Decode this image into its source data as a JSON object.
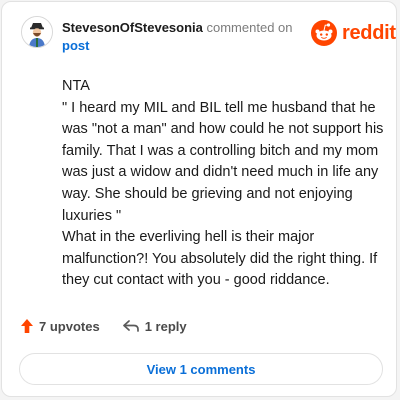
{
  "comment": {
    "username": "StevesonOfStevesonia",
    "action_text": " commented on",
    "post_link": "post",
    "body": [
      "NTA",
      "\" I heard my MIL and BIL tell me husband that he was \"not a man\" and how could he not support his family. That I was a controlling bitch and my mom was just a widow and didn't need much in life any way. She should be grieving and not enjoying luxuries \"",
      "What in the everliving hell is their major malfunction?! You absolutely did the right thing. If they cut contact with you - good riddance."
    ]
  },
  "brand": {
    "name": "reddit",
    "color": "#ff4500",
    "icon": "reddit-logo-icon"
  },
  "actions": {
    "upvotes_label": "7 upvotes",
    "upvote_icon": "upvote-arrow-icon",
    "upvote_color": "#ff4500",
    "reply_label": "1 reply",
    "reply_icon": "reply-arrow-icon"
  },
  "footer": {
    "view_comments_label": "View 1 comments",
    "link_color": "#0a6fd8"
  }
}
